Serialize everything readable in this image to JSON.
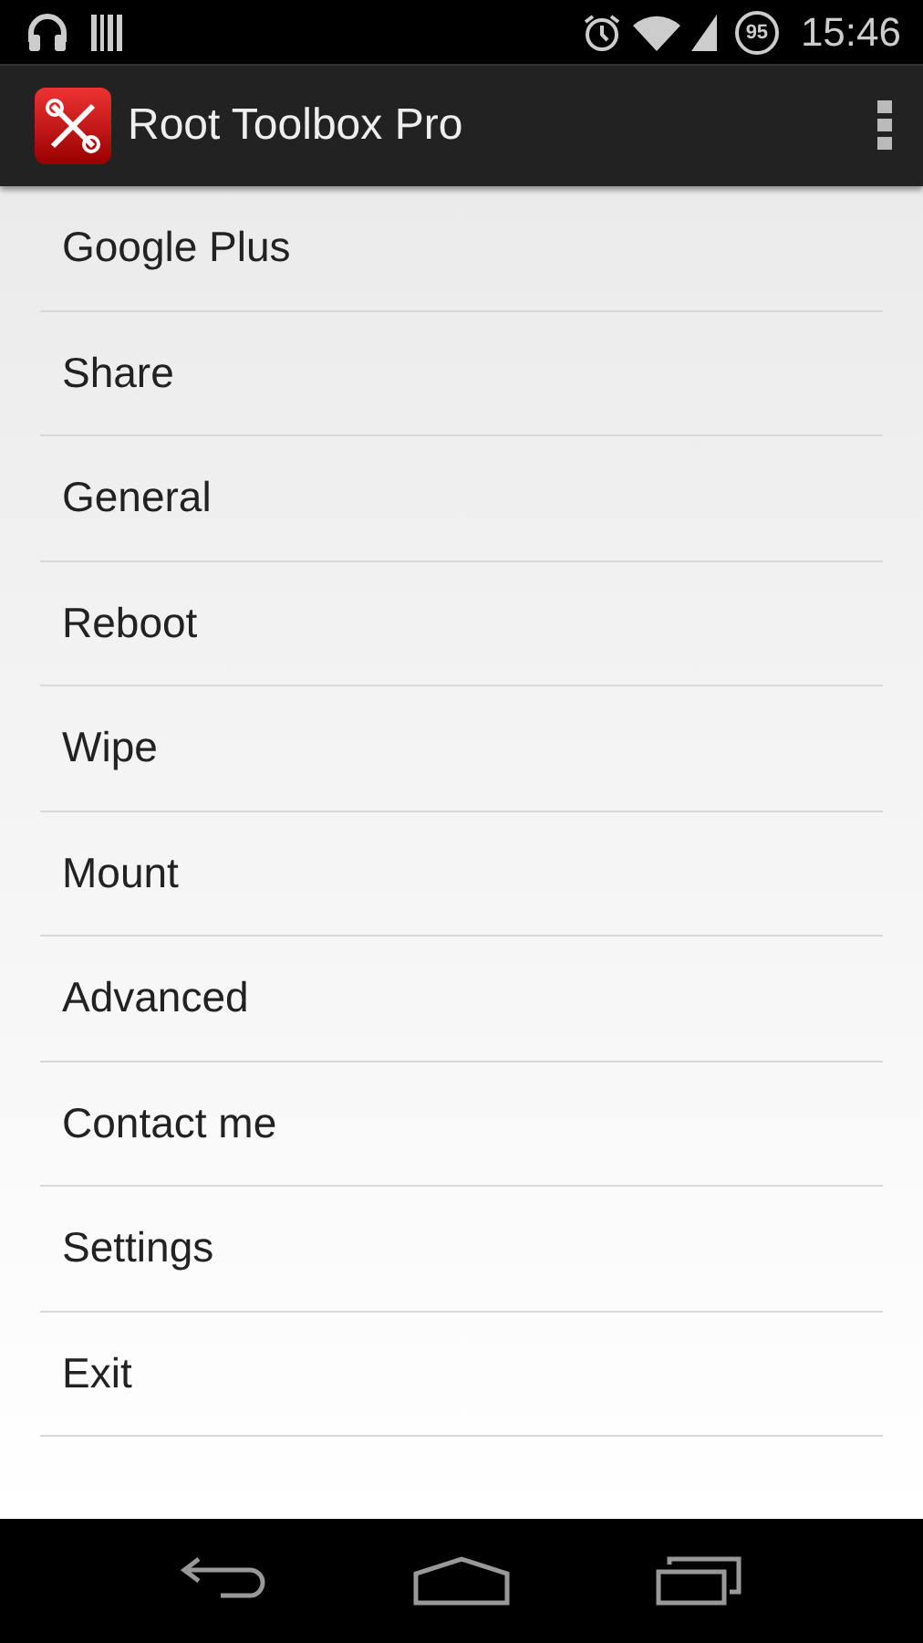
{
  "status_bar": {
    "battery": "95",
    "time": "15:46"
  },
  "action_bar": {
    "title": "Root Toolbox Pro"
  },
  "menu_items": [
    {
      "label": "Google Plus"
    },
    {
      "label": "Share"
    },
    {
      "label": "General"
    },
    {
      "label": "Reboot"
    },
    {
      "label": "Wipe"
    },
    {
      "label": "Mount"
    },
    {
      "label": "Advanced"
    },
    {
      "label": "Contact me"
    },
    {
      "label": "Settings"
    },
    {
      "label": "Exit"
    }
  ]
}
